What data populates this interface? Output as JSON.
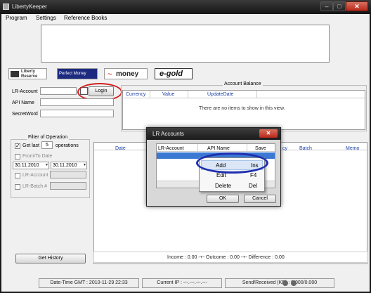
{
  "window": {
    "title": "LibertyKeeper"
  },
  "menu": [
    "Program",
    "Settings",
    "Reference Books"
  ],
  "logos": {
    "liberty_reserve": [
      "Liberty",
      "Reserve"
    ],
    "perfect_money": "Perfect Money",
    "webmoney": "money",
    "egold": "e-gold"
  },
  "account": {
    "lr_account_label": "LR-Account",
    "api_name_label": "API Name",
    "secret_word_label": "SecretWord",
    "login_button": "Login"
  },
  "balance": {
    "title": "Account Balance",
    "columns": [
      "Currency",
      "Value",
      "UpdateDate"
    ],
    "empty_text": "There are no items to show in this view."
  },
  "filter": {
    "title": "Filter of Operation",
    "get_last_label": "Get last",
    "get_last_value": "5",
    "operations_label": "operations",
    "from_to_label": "From/To Date",
    "date_from": "30.11.2010",
    "date_to": "30.11.2010",
    "lr_account_label": "LR-Account",
    "lr_batch_label": "LR-Batch #",
    "get_history_button": "Get History"
  },
  "history": {
    "columns": [
      "Date",
      "cy",
      "Batch",
      "Memo"
    ],
    "summary": "Income : 0.00 -+- Outcome : 0.00 -+- Difference : 0.00"
  },
  "status": {
    "datetime": "Date-Time GMT : 2010-11-29 22:33",
    "ip": "Current IP : ---.---.---.---",
    "traffic": "Send/Received (KB) : 0.000/0.000"
  },
  "dialog": {
    "title": "LR Accounts",
    "columns": [
      "LR-Account",
      "API Name",
      "Save"
    ],
    "ok_button": "OK",
    "cancel_button": "Cancel"
  },
  "context_menu": [
    {
      "label": "Add",
      "shortcut": "Ins"
    },
    {
      "label": "Edit",
      "shortcut": "F4"
    },
    {
      "label": "Delete",
      "shortcut": "Del"
    }
  ],
  "colors": {
    "annotation": "#1e2fb0",
    "login_annotation": "#d21f1f",
    "header_text": "#1c3fa8"
  }
}
